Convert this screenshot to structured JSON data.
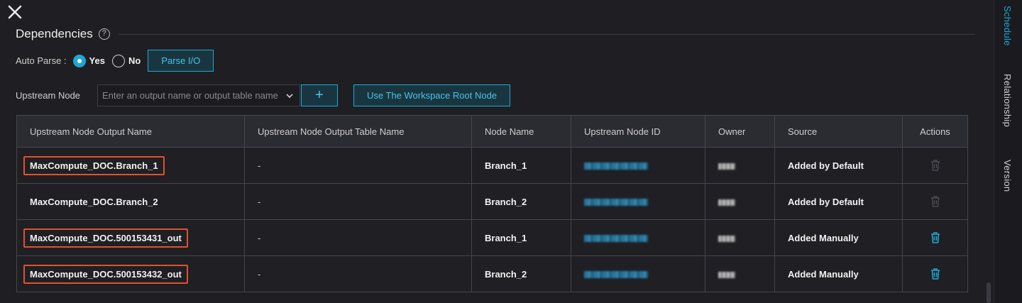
{
  "close_icon": "close-icon",
  "section": {
    "title": "Dependencies",
    "help": "?"
  },
  "auto_parse": {
    "label": "Auto Parse :",
    "yes": "Yes",
    "no": "No",
    "selected": "Yes",
    "parse_button": "Parse I/O"
  },
  "upstream": {
    "label": "Upstream Node",
    "placeholder": "Enter an output name or output table name",
    "add_button": "+",
    "root_button": "Use The Workspace Root Node"
  },
  "table": {
    "headers": [
      "Upstream Node Output Name",
      "Upstream Node Output Table Name",
      "Node Name",
      "Upstream Node ID",
      "Owner",
      "Source",
      "Actions"
    ],
    "rows": [
      {
        "output_name": "MaxCompute_DOC.Branch_1",
        "table_name": "-",
        "node_name": "Branch_1",
        "source": "Added by Default",
        "highlighted": true,
        "delete_enabled": false
      },
      {
        "output_name": "MaxCompute_DOC.Branch_2",
        "table_name": "-",
        "node_name": "Branch_2",
        "source": "Added by Default",
        "highlighted": false,
        "delete_enabled": false
      },
      {
        "output_name": "MaxCompute_DOC.500153431_out",
        "table_name": "-",
        "node_name": "Branch_1",
        "source": "Added Manually",
        "highlighted": true,
        "delete_enabled": true
      },
      {
        "output_name": "MaxCompute_DOC.500153432_out",
        "table_name": "-",
        "node_name": "Branch_2",
        "source": "Added Manually",
        "highlighted": true,
        "delete_enabled": true
      }
    ]
  },
  "side_tabs": {
    "schedule": "Schedule",
    "relationship": "Relationship",
    "version": "Version",
    "active": "Schedule"
  },
  "colors": {
    "accent": "#1ea7d6",
    "highlight": "#e0522d",
    "background": "#1f1f23"
  }
}
